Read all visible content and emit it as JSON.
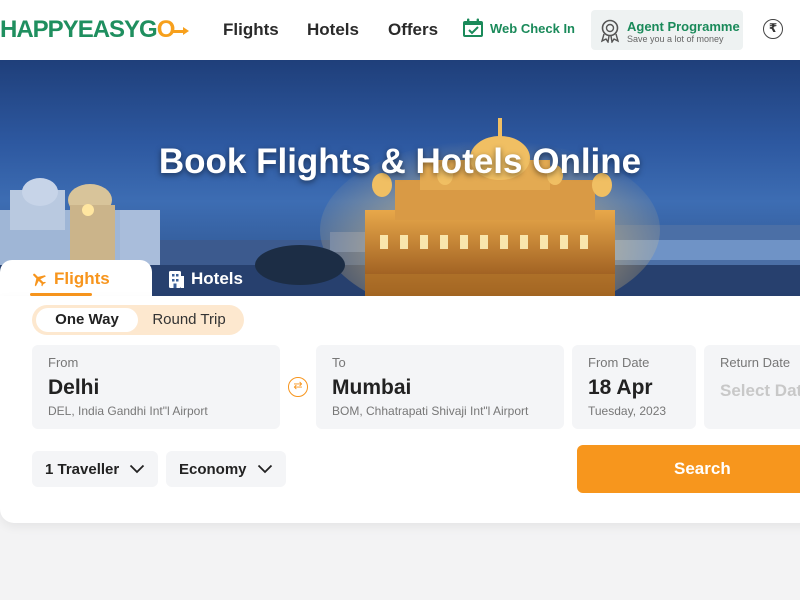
{
  "header": {
    "logo": {
      "text_main": "HAPPYEASYG",
      "text_accent": "O"
    },
    "nav": [
      {
        "label": "Flights"
      },
      {
        "label": "Hotels"
      },
      {
        "label": "Offers"
      }
    ],
    "web_check_in": {
      "label": "Web Check In",
      "icon": "calendar-check-icon"
    },
    "agent_programme": {
      "title": "Agent Programme",
      "subtitle": "Save you a lot of money",
      "icon": "award-badge-icon"
    },
    "currency_icon": {
      "symbol": "₹",
      "icon": "rupee-icon"
    }
  },
  "hero": {
    "title": "Book Flights & Hotels Online"
  },
  "tabs": [
    {
      "label": "Flights",
      "icon": "airplane-icon",
      "active": true
    },
    {
      "label": "Hotels",
      "icon": "hotel-building-icon",
      "active": false
    }
  ],
  "trip_type": {
    "options": [
      "One Way",
      "Round Trip"
    ],
    "selected": "One Way"
  },
  "search": {
    "from": {
      "label": "From",
      "city": "Delhi",
      "airport": "DEL, India Gandhi Int\"l Airport"
    },
    "swap_icon": "swap-arrows-icon",
    "to": {
      "label": "To",
      "city": "Mumbai",
      "airport": "BOM, Chhatrapati Shivaji Int\"l Airport"
    },
    "from_date": {
      "label": "From Date",
      "date": "18 Apr",
      "weekday_year": "Tuesday, 2023"
    },
    "return_date": {
      "label": "Return Date",
      "placeholder": "Select Date"
    },
    "travellers": {
      "value": "1 Traveller",
      "icon": "chevron-down-icon"
    },
    "cabin_class": {
      "value": "Economy",
      "icon": "chevron-down-icon"
    },
    "search_button": {
      "label": "Search"
    }
  },
  "colors": {
    "brand_green": "#1f8f5f",
    "accent_orange": "#f7961d",
    "hero_sky": "#2d58a0"
  }
}
